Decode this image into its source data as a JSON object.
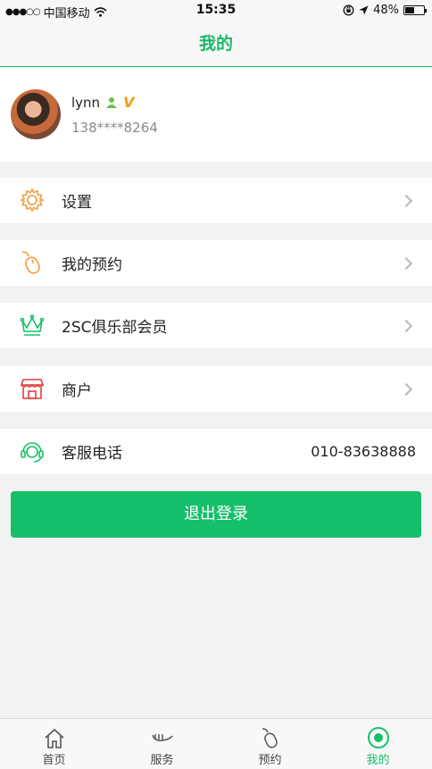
{
  "status_bar": {
    "carrier": "中国移动",
    "time": "15:35",
    "battery": "48%",
    "battery_level": 0.48
  },
  "nav": {
    "title": "我的"
  },
  "profile": {
    "username": "lynn",
    "vip_label": "V",
    "phone": "138****8264"
  },
  "menu": {
    "settings": "设置",
    "reservations": "我的预约",
    "club": "2SC俱乐部会员",
    "merchant": "商户",
    "service": "客服电话",
    "service_phone": "010-83638888"
  },
  "logout": {
    "label": "退出登录"
  },
  "tabs": {
    "home": "首页",
    "services": "服务",
    "booking": "预约",
    "mine": "我的"
  },
  "colors": {
    "accent": "#16bf6a",
    "icon_orange": "#f39c3a",
    "icon_red": "#e0403a"
  }
}
